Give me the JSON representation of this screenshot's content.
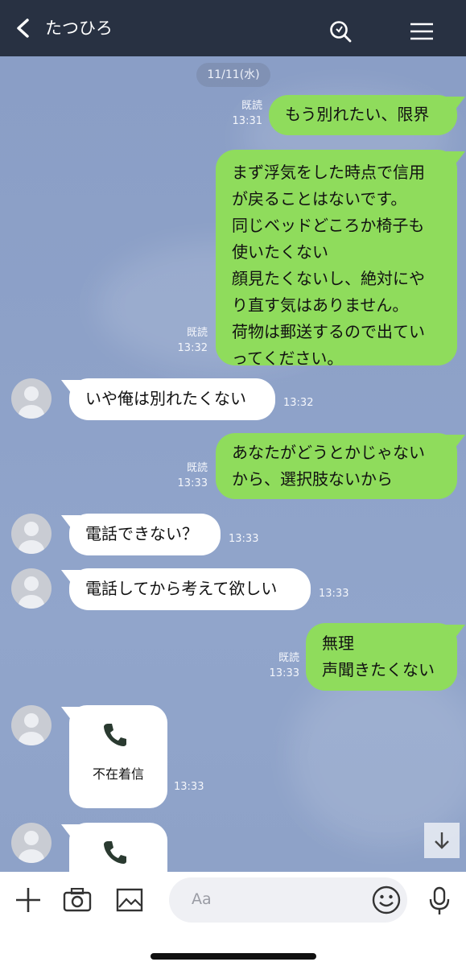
{
  "header": {
    "title": "たつひろ",
    "bg": "#283142"
  },
  "date_separator": "11/11(水)",
  "read_label": "既読",
  "messages": [
    {
      "from": "me",
      "text": "もう別れたい、限界",
      "time": "13:31",
      "read": true
    },
    {
      "from": "me",
      "text": "まず浮気をした時点で信用\nが戻ることはないです。\n同じベッドどころか椅子も\n使いたくない\n顔見たくないし、絶対にや\nり直す気はありません。\n荷物は郵送するので出てい\nってください。",
      "time": "13:32",
      "read": true
    },
    {
      "from": "them",
      "text": "いや俺は別れたくない",
      "time": "13:32"
    },
    {
      "from": "me",
      "text": "あなたがどうとかじゃない\nから、選択肢ないから",
      "time": "13:33",
      "read": true
    },
    {
      "from": "them",
      "text": "電話できない？",
      "time": "13:33"
    },
    {
      "from": "them",
      "text": "電話してから考えて欲しい",
      "time": "13:33"
    },
    {
      "from": "me",
      "text": "無理\n声聞きたくない",
      "time": "13:33",
      "read": true
    },
    {
      "from": "them",
      "type": "call",
      "text": "不在着信",
      "time": "13:33"
    }
  ],
  "input": {
    "placeholder": "Aa"
  },
  "colors": {
    "my_bubble": "#8fdc5c",
    "their_bubble": "#ffffff",
    "chat_bg": "#8ea2c8"
  }
}
